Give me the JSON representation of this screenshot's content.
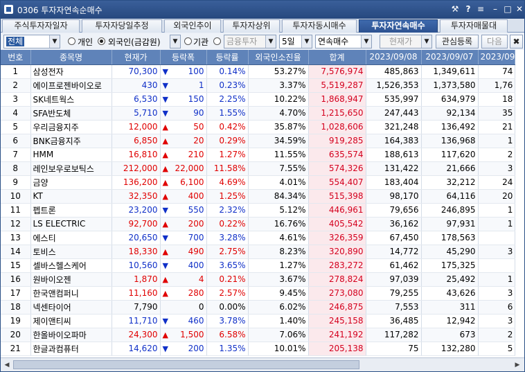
{
  "window": {
    "title": "0306 투자자연속순매수",
    "controls": [
      "⚒",
      "?",
      "≡",
      "–",
      "□",
      "✕"
    ]
  },
  "tabs": [
    {
      "label": "주식투자자일자",
      "active": false
    },
    {
      "label": "투자자당일추정",
      "active": false
    },
    {
      "label": "외국인추이",
      "active": false
    },
    {
      "label": "투자자상위",
      "active": false
    },
    {
      "label": "투자자동시매수",
      "active": false
    },
    {
      "label": "투자자연속매수",
      "active": true
    },
    {
      "label": "투자자매물대",
      "active": false
    }
  ],
  "toolbar": {
    "market_select": "전체",
    "radio_individual": "개인",
    "radio_foreign": "외국인(금감원)",
    "radio_institution": "기관",
    "institution_select": "금융투자",
    "days_select": "5일",
    "mode_select": "연속매수",
    "price_select": "현재가",
    "watch_button": "관심등록",
    "next_button": "다음",
    "close_glyph": "✖"
  },
  "table": {
    "columns": [
      "번호",
      "종목명",
      "현재가",
      "등락폭",
      "등락률",
      "외국인소진율",
      "합계",
      "2023/09/08",
      "2023/09/07",
      "2023/09"
    ],
    "rows": [
      {
        "no": "1",
        "name": "삼성전자",
        "price": "70,300",
        "dir": "down",
        "chg": "100",
        "rate": "0.14%",
        "foreign": "53.27%",
        "sum": "7,576,974",
        "d1": "485,863",
        "d2": "1,349,611",
        "d3": "74"
      },
      {
        "no": "2",
        "name": "에이프로젠바이오로",
        "price": "430",
        "dir": "down",
        "chg": "1",
        "rate": "0.23%",
        "foreign": "3.37%",
        "sum": "5,519,287",
        "d1": "1,526,353",
        "d2": "1,373,580",
        "d3": "1,76"
      },
      {
        "no": "3",
        "name": "SK네트웍스",
        "price": "6,530",
        "dir": "down",
        "chg": "150",
        "rate": "2.25%",
        "foreign": "10.22%",
        "sum": "1,868,947",
        "d1": "535,997",
        "d2": "634,979",
        "d3": "18"
      },
      {
        "no": "4",
        "name": "SFA반도체",
        "price": "5,710",
        "dir": "down",
        "chg": "90",
        "rate": "1.55%",
        "foreign": "4.70%",
        "sum": "1,215,650",
        "d1": "247,443",
        "d2": "92,134",
        "d3": "35"
      },
      {
        "no": "5",
        "name": "우리금융지주",
        "price": "12,000",
        "dir": "up",
        "chg": "50",
        "rate": "0.42%",
        "foreign": "35.87%",
        "sum": "1,028,606",
        "d1": "321,248",
        "d2": "136,492",
        "d3": "21"
      },
      {
        "no": "6",
        "name": "BNK금융지주",
        "price": "6,850",
        "dir": "up",
        "chg": "20",
        "rate": "0.29%",
        "foreign": "34.59%",
        "sum": "919,285",
        "d1": "164,383",
        "d2": "136,968",
        "d3": "1"
      },
      {
        "no": "7",
        "name": "HMM",
        "price": "16,810",
        "dir": "up",
        "chg": "210",
        "rate": "1.27%",
        "foreign": "11.55%",
        "sum": "635,574",
        "d1": "188,613",
        "d2": "117,620",
        "d3": "2"
      },
      {
        "no": "8",
        "name": "레인보우로보틱스",
        "price": "212,000",
        "dir": "up",
        "chg": "22,000",
        "rate": "11.58%",
        "foreign": "7.55%",
        "sum": "574,326",
        "d1": "131,422",
        "d2": "21,666",
        "d3": "3"
      },
      {
        "no": "9",
        "name": "금양",
        "price": "136,200",
        "dir": "up",
        "chg": "6,100",
        "rate": "4.69%",
        "foreign": "4.01%",
        "sum": "554,407",
        "d1": "183,404",
        "d2": "32,212",
        "d3": "24"
      },
      {
        "no": "10",
        "name": "KT",
        "price": "32,350",
        "dir": "up",
        "chg": "400",
        "rate": "1.25%",
        "foreign": "84.34%",
        "sum": "515,398",
        "d1": "98,170",
        "d2": "64,116",
        "d3": "20"
      },
      {
        "no": "11",
        "name": "펩트론",
        "price": "23,200",
        "dir": "down",
        "chg": "550",
        "rate": "2.32%",
        "foreign": "5.12%",
        "sum": "446,961",
        "d1": "79,656",
        "d2": "246,895",
        "d3": "1"
      },
      {
        "no": "12",
        "name": "LS ELECTRIC",
        "price": "92,700",
        "dir": "up",
        "chg": "200",
        "rate": "0.22%",
        "foreign": "16.76%",
        "sum": "405,542",
        "d1": "36,162",
        "d2": "97,931",
        "d3": "1"
      },
      {
        "no": "13",
        "name": "에스티",
        "price": "20,650",
        "dir": "down",
        "chg": "700",
        "rate": "3.28%",
        "foreign": "4.61%",
        "sum": "326,359",
        "d1": "67,450",
        "d2": "178,563",
        "d3": ""
      },
      {
        "no": "14",
        "name": "토비스",
        "price": "18,330",
        "dir": "up",
        "chg": "490",
        "rate": "2.75%",
        "foreign": "8.23%",
        "sum": "320,890",
        "d1": "14,772",
        "d2": "45,290",
        "d3": "3"
      },
      {
        "no": "15",
        "name": "셀바스헬스케어",
        "price": "10,560",
        "dir": "down",
        "chg": "400",
        "rate": "3.65%",
        "foreign": "1.27%",
        "sum": "283,272",
        "d1": "61,462",
        "d2": "175,325",
        "d3": ""
      },
      {
        "no": "16",
        "name": "원바이오젠",
        "price": "1,870",
        "dir": "up",
        "chg": "4",
        "rate": "0.21%",
        "foreign": "3.67%",
        "sum": "278,824",
        "d1": "97,039",
        "d2": "25,492",
        "d3": "1"
      },
      {
        "no": "17",
        "name": "한국앤컴퍼니",
        "price": "11,160",
        "dir": "up",
        "chg": "280",
        "rate": "2.57%",
        "foreign": "9.45%",
        "sum": "273,080",
        "d1": "79,255",
        "d2": "43,626",
        "d3": "3"
      },
      {
        "no": "18",
        "name": "넥센타이어",
        "price": "7,790",
        "dir": "flat",
        "chg": "0",
        "rate": "0.00%",
        "foreign": "6.02%",
        "sum": "246,875",
        "d1": "7,553",
        "d2": "311",
        "d3": "6"
      },
      {
        "no": "19",
        "name": "제이앤티씨",
        "price": "11,710",
        "dir": "down",
        "chg": "460",
        "rate": "3.78%",
        "foreign": "1.40%",
        "sum": "245,158",
        "d1": "36,485",
        "d2": "12,942",
        "d3": "3"
      },
      {
        "no": "20",
        "name": "한올바이오파마",
        "price": "24,300",
        "dir": "up",
        "chg": "1,500",
        "rate": "6.58%",
        "foreign": "7.06%",
        "sum": "241,192",
        "d1": "117,282",
        "d2": "673",
        "d3": "2"
      },
      {
        "no": "21",
        "name": "한글과컴퓨터",
        "price": "14,620",
        "dir": "down",
        "chg": "200",
        "rate": "1.35%",
        "foreign": "10.01%",
        "sum": "205,138",
        "d1": "75",
        "d2": "132,280",
        "d3": "5"
      }
    ]
  }
}
